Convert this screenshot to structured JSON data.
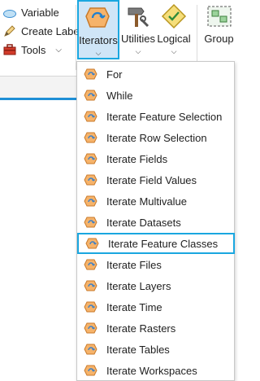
{
  "ribbon": {
    "small_commands": [
      {
        "label": "Variable",
        "icon": "variable-icon"
      },
      {
        "label": "Create Label",
        "icon": "pen-icon"
      },
      {
        "label": "Tools",
        "icon": "toolbox-icon",
        "has_dropdown": true
      }
    ],
    "iterators": {
      "label": "Iterators",
      "icon": "iterators-icon",
      "active": true
    },
    "utilities": {
      "label": "Utilities",
      "icon": "utilities-icon"
    },
    "logical": {
      "label": "Logical",
      "icon": "logical-icon"
    },
    "group": {
      "label": "Group",
      "icon": "group-icon"
    },
    "dropdown_arrow": "˅"
  },
  "menu": {
    "items": [
      {
        "label": "For"
      },
      {
        "label": "While"
      },
      {
        "label": "Iterate Feature Selection"
      },
      {
        "label": "Iterate Row Selection"
      },
      {
        "label": "Iterate Fields"
      },
      {
        "label": "Iterate Field Values"
      },
      {
        "label": "Iterate Multivalue"
      },
      {
        "label": "Iterate Datasets"
      },
      {
        "label": "Iterate Feature Classes",
        "highlighted": true
      },
      {
        "label": "Iterate Files"
      },
      {
        "label": "Iterate Layers"
      },
      {
        "label": "Iterate Time"
      },
      {
        "label": "Iterate Rasters"
      },
      {
        "label": "Iterate Tables"
      },
      {
        "label": "Iterate Workspaces"
      }
    ],
    "icon": "iterator-icon"
  },
  "colors": {
    "accent": "#1aa7e0",
    "active_fill": "#cfe5f7",
    "iterator_orange": "#f0a85a"
  }
}
